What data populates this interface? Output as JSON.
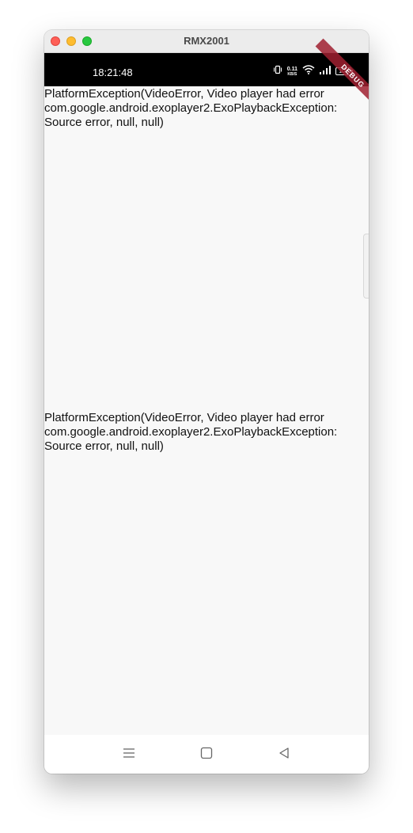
{
  "window": {
    "title": "RMX2001"
  },
  "status_bar": {
    "time": "18:21:48",
    "net_speed_value": "0.11",
    "net_speed_unit": "KB/S",
    "battery_level": "105",
    "icons": [
      "vibrate-icon",
      "wifi-icon",
      "signal-icon",
      "battery-icon"
    ]
  },
  "debug_banner": {
    "label": "DEBUG"
  },
  "content": {
    "errors": [
      "PlatformException(VideoError, Video player had error com.google.android.exoplayer2.ExoPlaybackException: Source error, null, null)",
      "PlatformException(VideoError, Video player had error com.google.android.exoplayer2.ExoPlaybackException: Source error, null, null)"
    ]
  },
  "nav_bar": {
    "icons": [
      "menu-icon",
      "home-icon",
      "back-icon"
    ]
  },
  "colors": {
    "status_bar_bg": "#000000",
    "content_bg": "#f8f8f8",
    "debug_ribbon": "#a02030",
    "text": "#111111"
  }
}
